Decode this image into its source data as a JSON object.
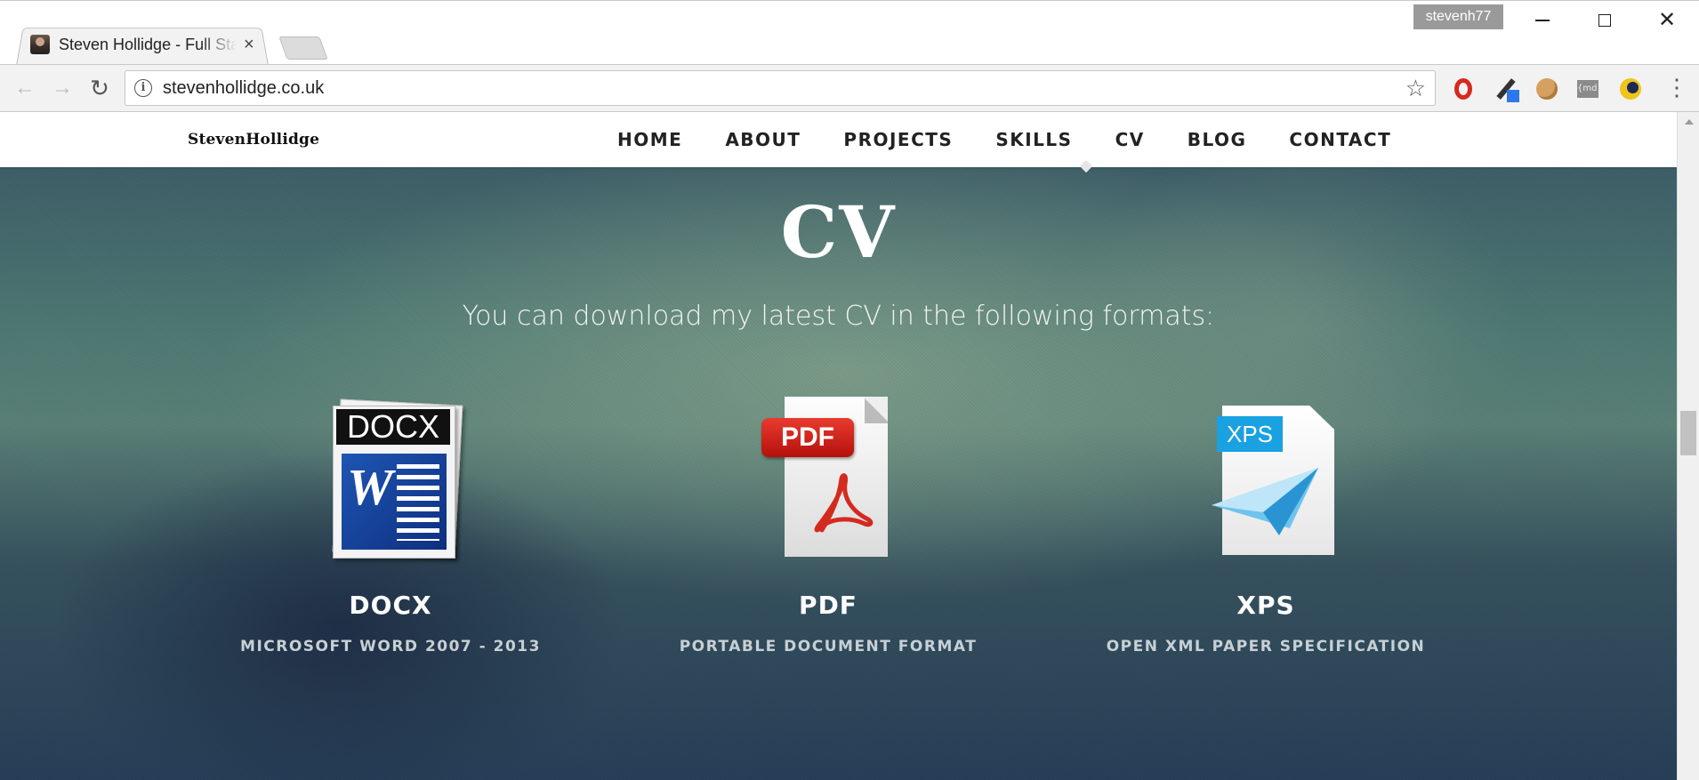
{
  "browser": {
    "tab_title": "Steven Hollidge - Full Stack",
    "tab_close": "×",
    "profile_name": "stevenh77",
    "url": "stevenhollidge.co.uk",
    "info_icon_glyph": "i",
    "bookmark_star": "☆",
    "back_glyph": "←",
    "forward_glyph": "→",
    "reload_glyph": "↻",
    "menu_glyph": "⋮",
    "close_glyph": "✕",
    "md_ext_label": "{md}"
  },
  "site": {
    "logo": "StevenHollidge",
    "nav": [
      "HOME",
      "ABOUT",
      "PROJECTS",
      "SKILLS",
      "CV",
      "BLOG",
      "CONTACT"
    ],
    "active_nav": "CV"
  },
  "hero": {
    "title": "CV",
    "subtitle": "You can download my latest CV in the following formats:"
  },
  "formats": [
    {
      "icon_label": "DOCX",
      "name": "DOCX",
      "description": "MICROSOFT WORD 2007 - 2013",
      "icon": "word-docx-icon"
    },
    {
      "icon_label": "PDF",
      "name": "PDF",
      "description": "PORTABLE DOCUMENT FORMAT",
      "icon": "pdf-icon"
    },
    {
      "icon_label": "XPS",
      "name": "XPS",
      "description": "OPEN XML PAPER SPECIFICATION",
      "icon": "xps-icon"
    }
  ],
  "colors": {
    "pdf_red": "#d42a1e",
    "xps_blue": "#19a1e2",
    "word_blue": "#1e56b3"
  }
}
